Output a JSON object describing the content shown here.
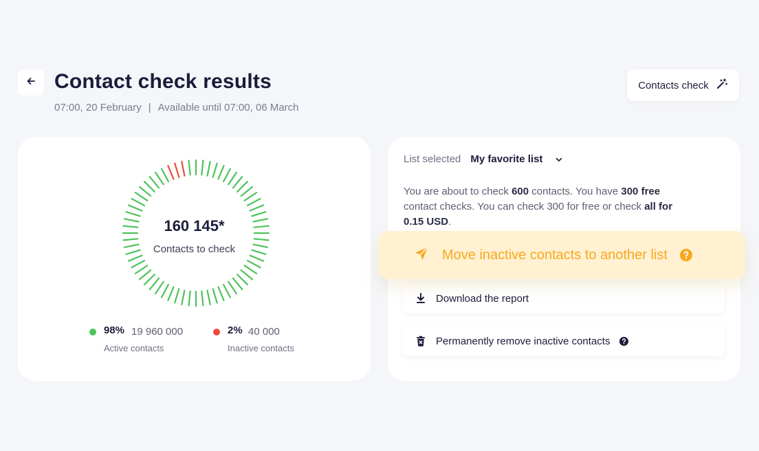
{
  "header": {
    "title": "Contact check results",
    "date": "07:00, 20 February",
    "separator": "|",
    "available": "Available until 07:00, 06 March",
    "contacts_check_label": "Contacts check"
  },
  "gauge": {
    "value": "160 145*",
    "label": "Contacts to check",
    "active_fraction": 0.98,
    "inactive_fraction": 0.02,
    "colors": {
      "active": "#4cc35a",
      "inactive": "#ef4b3c"
    }
  },
  "stats": {
    "active": {
      "pct": "98%",
      "count": "19 960 000",
      "label": "Active contacts",
      "color": "#4cc35a"
    },
    "inactive": {
      "pct": "2%",
      "count": "40 000",
      "label": "Inactive contacts",
      "color": "#ef4b3c"
    }
  },
  "list": {
    "label": "List selected",
    "selected": "My favorite list"
  },
  "description": {
    "p1": "You are about to check ",
    "contacts": "600",
    "p2": " contacts. You have ",
    "free": "300 free",
    "p3": " contact checks. You can check 300 for free or check ",
    "all": "all for 0.15 USD",
    "p4": "."
  },
  "actions": {
    "move": "Move inactive contacts to another list",
    "download": "Download the report",
    "remove": "Permanently remove inactive contacts"
  },
  "icons": {
    "back": "arrow-left-icon",
    "magic": "magic-wand-icon",
    "chevron": "chevron-down-icon",
    "send": "send-icon",
    "help": "help-icon",
    "download": "download-icon",
    "trash": "trash-icon"
  },
  "colors": {
    "accent": "#f8a81e",
    "move_bg": "#fff1d1",
    "text_dark": "#1b1c3b"
  }
}
